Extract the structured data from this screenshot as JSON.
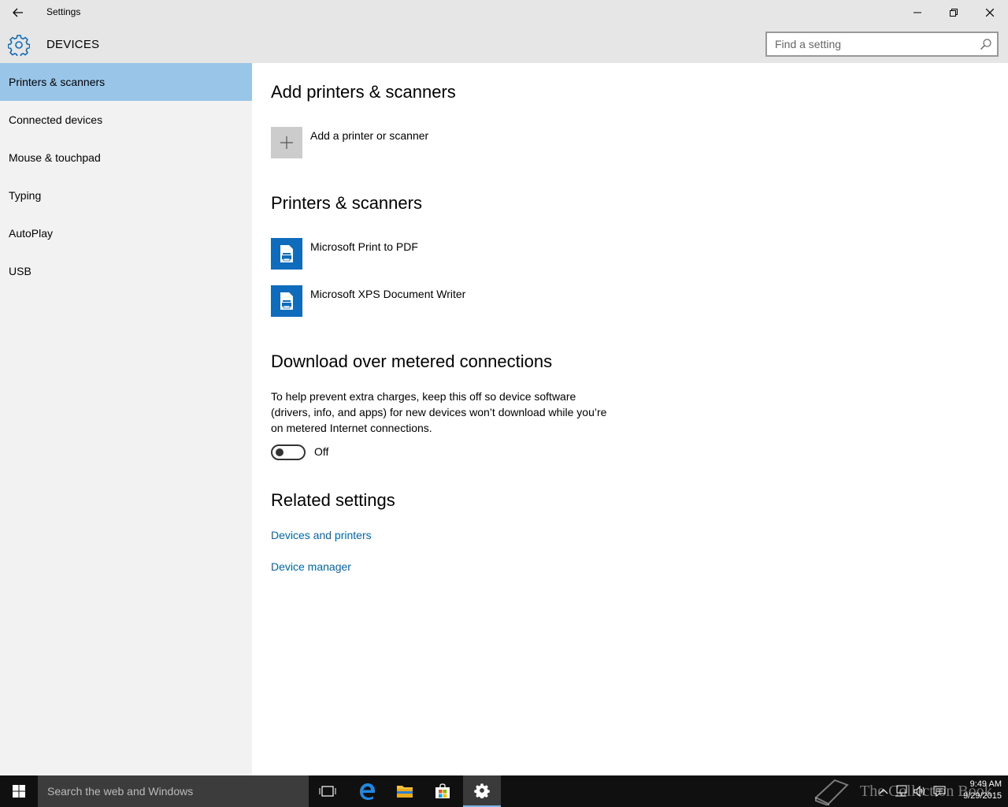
{
  "window": {
    "title": "Settings",
    "section": "DEVICES",
    "search_placeholder": "Find a setting"
  },
  "sidebar": {
    "items": [
      {
        "label": "Printers & scanners",
        "active": true
      },
      {
        "label": "Connected devices",
        "active": false
      },
      {
        "label": "Mouse & touchpad",
        "active": false
      },
      {
        "label": "Typing",
        "active": false
      },
      {
        "label": "AutoPlay",
        "active": false
      },
      {
        "label": "USB",
        "active": false
      }
    ]
  },
  "main": {
    "add_heading": "Add printers & scanners",
    "add_label": "Add a printer or scanner",
    "printers_heading": "Printers & scanners",
    "printers": [
      "Microsoft Print to PDF",
      "Microsoft XPS Document Writer"
    ],
    "metered_heading": "Download over metered connections",
    "metered_desc": "To help prevent extra charges, keep this off so device software (drivers, info, and apps) for new devices won’t download while you’re on metered Internet connections.",
    "toggle_state": "Off",
    "related_heading": "Related settings",
    "links": [
      "Devices and printers",
      "Device manager"
    ]
  },
  "taskbar": {
    "search_placeholder": "Search the web and Windows",
    "time": "9:49 AM",
    "date": "9/29/2015",
    "watermark": "The Collection Book"
  },
  "colors": {
    "accent": "#0f6cbd",
    "nav_active": "#99c5e8",
    "link": "#0066b4",
    "chrome": "#e6e6e6",
    "sidebar": "#f2f2f2",
    "taskbar": "#101010"
  }
}
